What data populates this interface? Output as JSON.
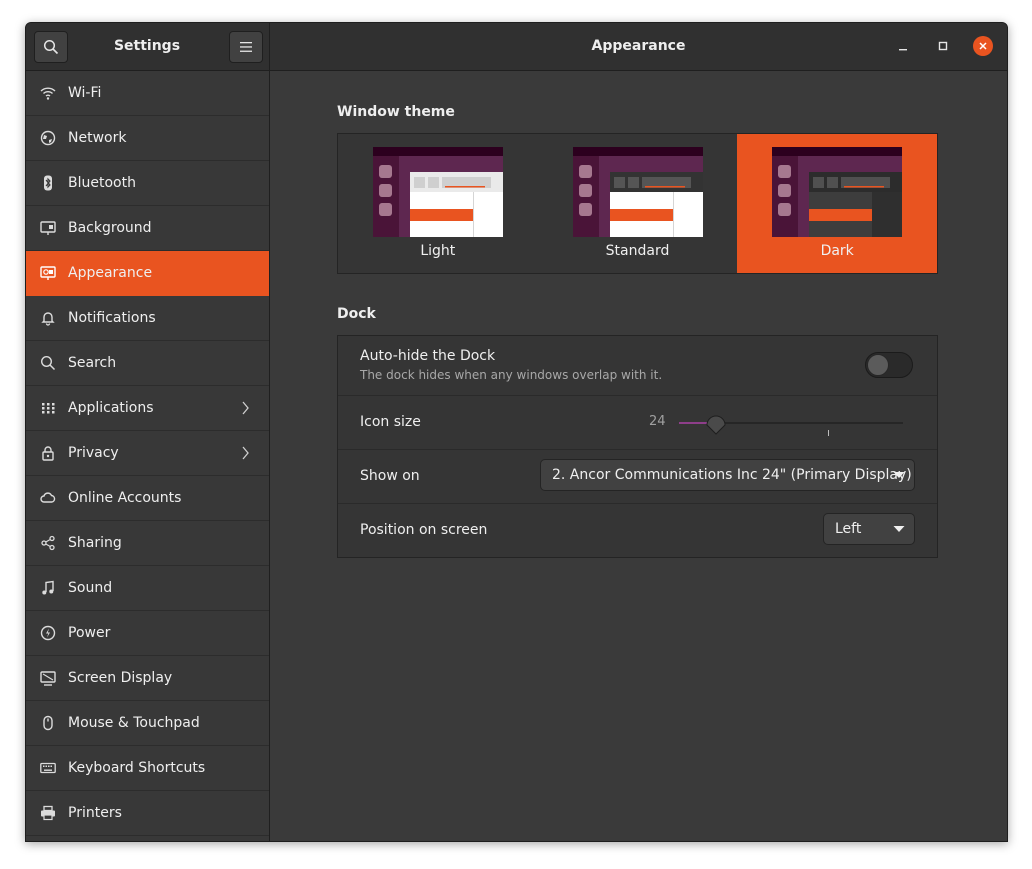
{
  "app": {
    "title": "Settings"
  },
  "page": {
    "title": "Appearance"
  },
  "sidebar": {
    "items": [
      {
        "label": "Wi-Fi",
        "icon": "wifi-icon"
      },
      {
        "label": "Network",
        "icon": "network-icon"
      },
      {
        "label": "Bluetooth",
        "icon": "bluetooth-icon"
      },
      {
        "label": "Background",
        "icon": "background-icon"
      },
      {
        "label": "Appearance",
        "icon": "appearance-icon",
        "active": true
      },
      {
        "label": "Notifications",
        "icon": "bell-icon"
      },
      {
        "label": "Search",
        "icon": "search-icon"
      },
      {
        "label": "Applications",
        "icon": "grid-icon",
        "has_submenu": true
      },
      {
        "label": "Privacy",
        "icon": "lock-icon",
        "has_submenu": true
      },
      {
        "label": "Online Accounts",
        "icon": "cloud-icon"
      },
      {
        "label": "Sharing",
        "icon": "share-icon"
      },
      {
        "label": "Sound",
        "icon": "music-note-icon"
      },
      {
        "label": "Power",
        "icon": "power-icon"
      },
      {
        "label": "Screen Display",
        "icon": "display-icon"
      },
      {
        "label": "Mouse & Touchpad",
        "icon": "mouse-icon"
      },
      {
        "label": "Keyboard Shortcuts",
        "icon": "keyboard-icon"
      },
      {
        "label": "Printers",
        "icon": "printer-icon"
      }
    ]
  },
  "window_theme": {
    "title": "Window theme",
    "options": [
      {
        "label": "Light",
        "selected": false
      },
      {
        "label": "Standard",
        "selected": false
      },
      {
        "label": "Dark",
        "selected": true
      }
    ]
  },
  "dock": {
    "title": "Dock",
    "autohide": {
      "label": "Auto-hide the Dock",
      "sublabel": "The dock hides when any windows overlap with it.",
      "enabled": false
    },
    "icon_size": {
      "label": "Icon size",
      "value": "24",
      "min": 16,
      "max": 64,
      "numeric_value": 24
    },
    "show_on": {
      "label": "Show on",
      "value": "2. Ancor Communications Inc 24\" (Primary Display)"
    },
    "position": {
      "label": "Position on screen",
      "value": "Left"
    }
  },
  "colors": {
    "accent": "#e95420",
    "aubergine": "#77216f"
  }
}
